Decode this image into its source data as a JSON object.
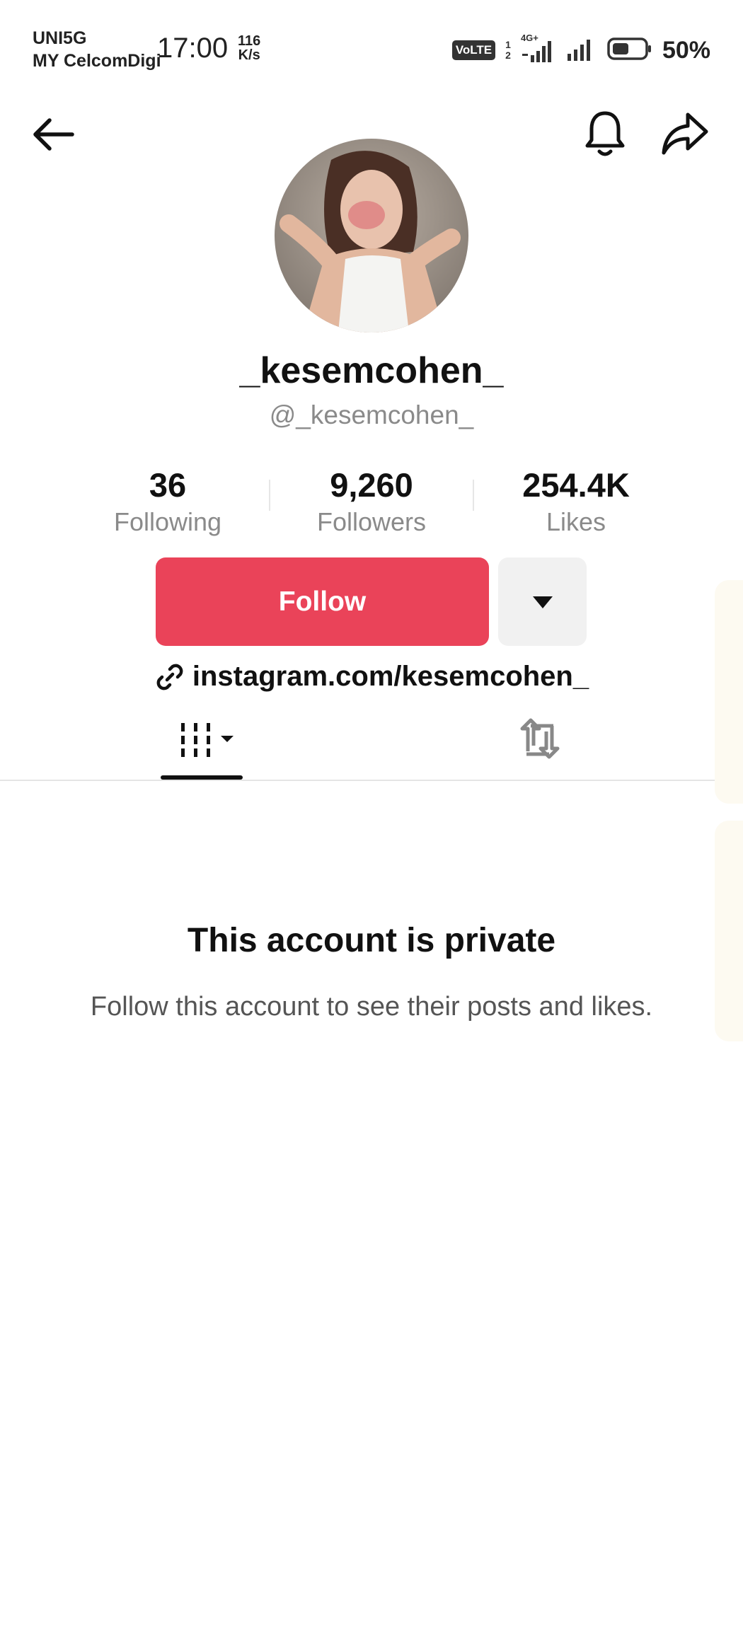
{
  "status_bar": {
    "carrier_line1": "UNI5G",
    "carrier_line2": "MY CelcomDigi",
    "time": "17:00",
    "speed_value": "116",
    "speed_unit": "K/s",
    "volte_label": "VoLTE",
    "sim_top": "1",
    "sim_bottom": "2",
    "network_type": "4G+",
    "battery_percent": "50%"
  },
  "header": {
    "back_icon": "back-arrow-icon",
    "notification_icon": "bell-icon",
    "share_icon": "share-icon"
  },
  "profile": {
    "display_name": "_kesemcohen_",
    "username": "@_kesemcohen_",
    "stats": [
      {
        "value": "36",
        "label": "Following"
      },
      {
        "value": "9,260",
        "label": "Followers"
      },
      {
        "value": "254.4K",
        "label": "Likes"
      }
    ],
    "follow_label": "Follow",
    "link_text": "instagram.com/kesemcohen_"
  },
  "tabs": {
    "videos_icon": "videos-grid-icon",
    "reposts_icon": "repost-icon"
  },
  "private_notice": {
    "title": "This account is private",
    "subtitle": "Follow this account to see their posts and likes."
  },
  "colors": {
    "accent": "#ea4359",
    "secondary_text": "#8a8a8a"
  }
}
